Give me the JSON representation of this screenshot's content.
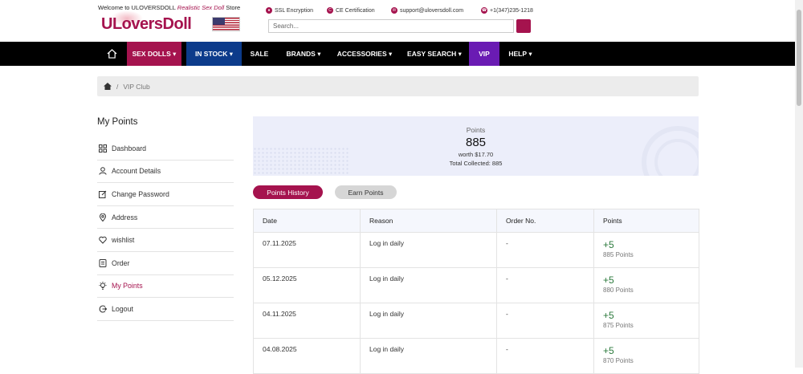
{
  "header": {
    "welcome_prefix": "Welcome to ULOVERSDOLL",
    "welcome_accent": "Realistic Sex Doll",
    "welcome_suffix": "Store",
    "logo": "ULoversDoll",
    "badges": [
      {
        "icon": "lock-icon",
        "label": "SSL Encryption"
      },
      {
        "icon": "ce-icon",
        "label": "CE Certification"
      },
      {
        "icon": "mail-icon",
        "label": "support@uloversdoll.com"
      },
      {
        "icon": "phone-icon",
        "label": "+1(347)235-1218"
      }
    ],
    "search_placeholder": "Search...",
    "accent_color": "#a5134e"
  },
  "nav": {
    "items": [
      {
        "label": "SEX DOLLS",
        "caret": true
      },
      {
        "label": "IN STOCK",
        "caret": true
      },
      {
        "label": "SALE",
        "caret": false
      },
      {
        "label": "BRANDS",
        "caret": true
      },
      {
        "label": "ACCESSORIES",
        "caret": true
      },
      {
        "label": "EASY SEARCH",
        "caret": true
      },
      {
        "label": "VIP",
        "caret": false
      },
      {
        "label": "HELP",
        "caret": true
      }
    ]
  },
  "breadcrumb": {
    "current": "VIP Club"
  },
  "sidebar": {
    "title": "My Points",
    "items": [
      {
        "icon": "dashboard-icon",
        "label": "Dashboard"
      },
      {
        "icon": "user-icon",
        "label": "Account Details"
      },
      {
        "icon": "edit-icon",
        "label": "Change Password"
      },
      {
        "icon": "location-icon",
        "label": "Address"
      },
      {
        "icon": "heart-icon",
        "label": "wishlist"
      },
      {
        "icon": "order-icon",
        "label": "Order"
      },
      {
        "icon": "bulb-icon",
        "label": "My Points",
        "active": true
      },
      {
        "icon": "logout-icon",
        "label": "Logout"
      }
    ]
  },
  "points": {
    "label": "Points",
    "value": "885",
    "worth": "worth $17.70",
    "total": "Total Collected: 885"
  },
  "tabs": {
    "history": "Points History",
    "earn": "Earn Points"
  },
  "table": {
    "headers": [
      "Date",
      "Reason",
      "Order No.",
      "Points"
    ],
    "rows": [
      {
        "date": "07.11.2025",
        "reason": "Log in daily",
        "order": "-",
        "delta": "+5",
        "total": "885 Points"
      },
      {
        "date": "05.12.2025",
        "reason": "Log in daily",
        "order": "-",
        "delta": "+5",
        "total": "880 Points"
      },
      {
        "date": "04.11.2025",
        "reason": "Log in daily",
        "order": "-",
        "delta": "+5",
        "total": "875 Points"
      },
      {
        "date": "04.08.2025",
        "reason": "Log in daily",
        "order": "-",
        "delta": "+5",
        "total": "870 Points"
      }
    ]
  }
}
